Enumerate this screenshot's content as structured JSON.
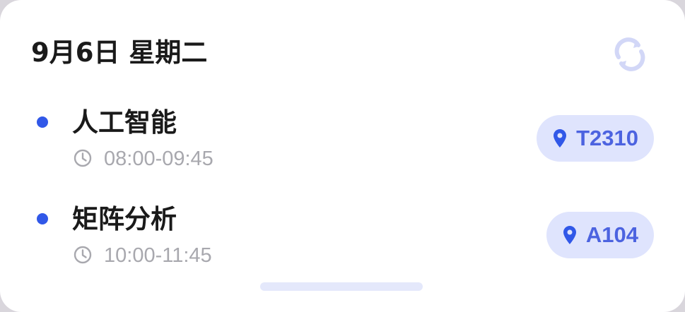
{
  "header": {
    "date_title": "9月6日 星期二",
    "refresh_icon": "refresh-icon"
  },
  "courses": [
    {
      "name": "人工智能",
      "time": "08:00-09:45",
      "room": "T2310"
    },
    {
      "name": "矩阵分析",
      "time": "10:00-11:45",
      "room": "A104"
    }
  ],
  "colors": {
    "accent": "#3158e8",
    "badge_bg": "#dfe4fd",
    "badge_text": "#4c63e0",
    "refresh_icon": "#d2d7f7",
    "home_indicator": "#e4e8fb",
    "time_text": "#a8a8ae"
  }
}
